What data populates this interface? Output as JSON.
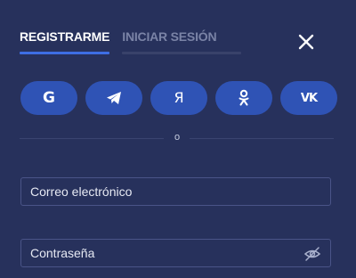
{
  "tabs": {
    "register": "REGISTRARME",
    "login": "INICIAR SESIÓN"
  },
  "social": [
    {
      "name": "google",
      "glyph": "G"
    },
    {
      "name": "telegram",
      "glyph": ""
    },
    {
      "name": "yandex",
      "glyph": "Я"
    },
    {
      "name": "odnoklassniki",
      "glyph": ""
    },
    {
      "name": "vk",
      "glyph": "VK"
    }
  ],
  "divider": {
    "label": "o"
  },
  "form": {
    "email_placeholder": "Correo electrónico",
    "password_placeholder": "Contraseña"
  },
  "colors": {
    "background": "#27315c",
    "accent": "#3e6ee3",
    "social_button": "#2f53b5"
  }
}
